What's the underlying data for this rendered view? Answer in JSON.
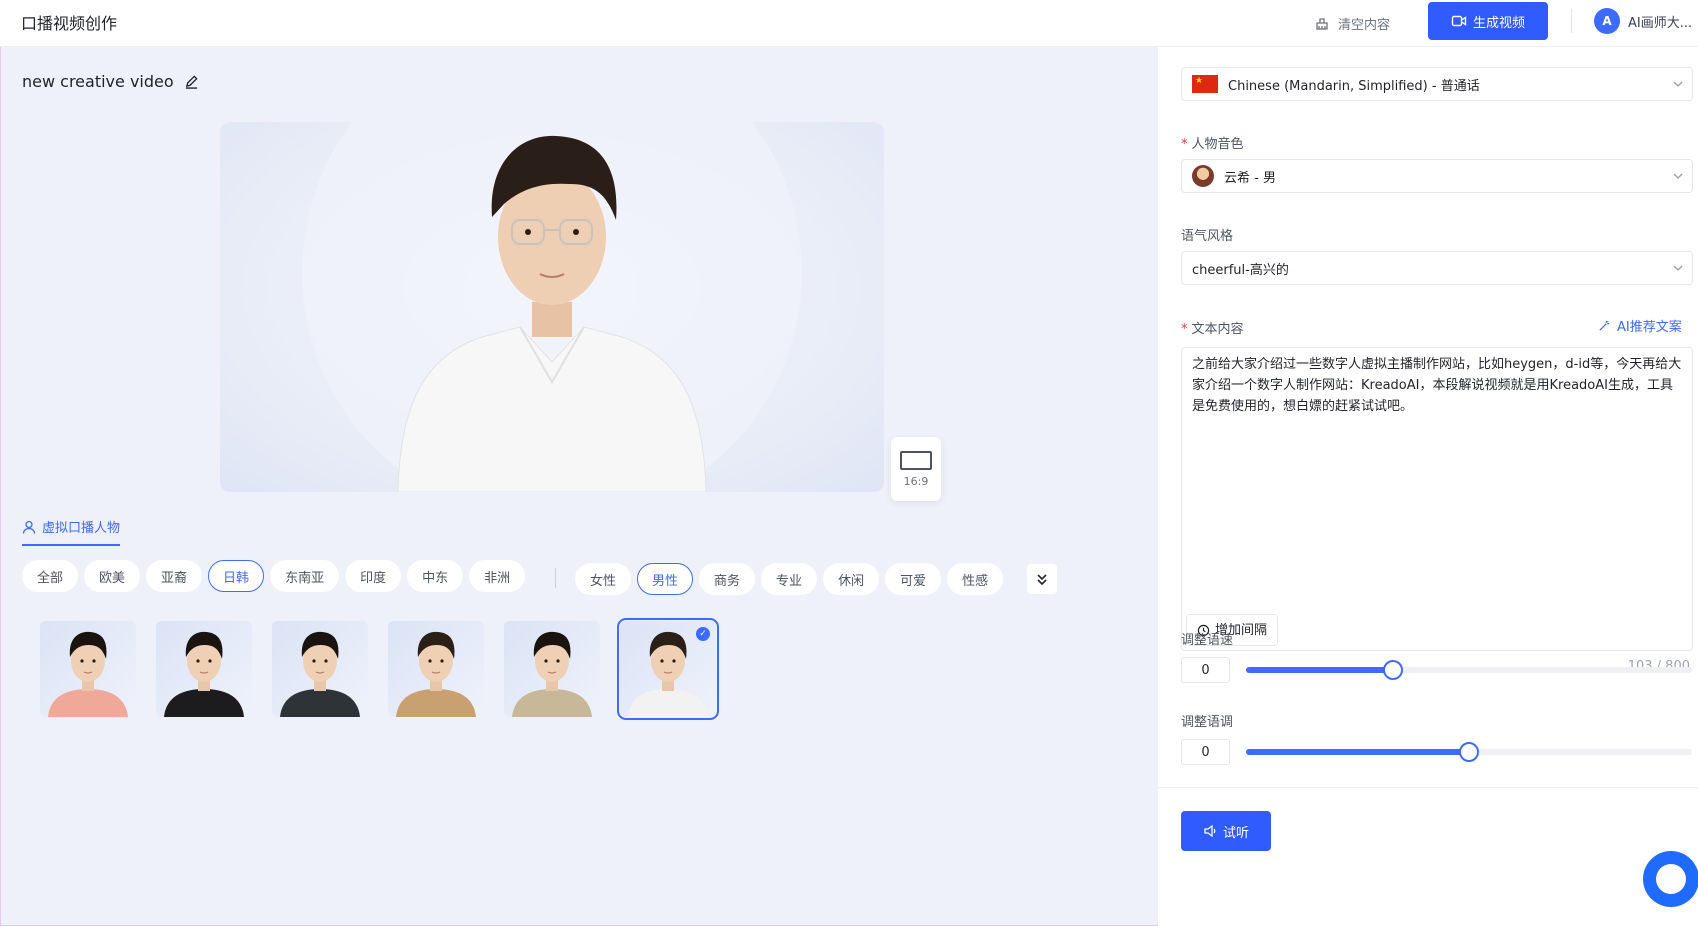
{
  "header": {
    "app_title": "口播视频创作",
    "clear_label": "清空内容",
    "generate_label": "生成视频",
    "avatar_initial": "A",
    "user_name": "AI画师大..."
  },
  "editor": {
    "video_title": "new creative video",
    "aspect_ratio": "16:9",
    "section_tab": "虚拟口播人物",
    "region_filters": [
      {
        "label": "全部",
        "active": false
      },
      {
        "label": "欧美",
        "active": false
      },
      {
        "label": "亚裔",
        "active": false
      },
      {
        "label": "日韩",
        "active": true
      },
      {
        "label": "东南亚",
        "active": false
      },
      {
        "label": "印度",
        "active": false
      },
      {
        "label": "中东",
        "active": false
      },
      {
        "label": "非洲",
        "active": false
      }
    ],
    "tag_filters": [
      {
        "label": "女性",
        "active": false
      },
      {
        "label": "男性",
        "active": true
      },
      {
        "label": "商务",
        "active": false
      },
      {
        "label": "专业",
        "active": false
      },
      {
        "label": "休闲",
        "active": false
      },
      {
        "label": "可爱",
        "active": false
      },
      {
        "label": "性感",
        "active": false
      }
    ],
    "avatars": [
      {
        "shirt": "#f0a898",
        "hair": "#1a1410",
        "selected": false
      },
      {
        "shirt": "#1c1c1e",
        "hair": "#1a1410",
        "selected": false
      },
      {
        "shirt": "#2e3338",
        "hair": "#1a1410",
        "selected": false
      },
      {
        "shirt": "#c9a070",
        "hair": "#2a2018",
        "selected": false
      },
      {
        "shirt": "#c8b89a",
        "hair": "#1a1410",
        "selected": false
      },
      {
        "shirt": "#f2f2f2",
        "hair": "#2a2018",
        "selected": true
      }
    ]
  },
  "panel": {
    "language": "Chinese (Mandarin, Simplified) - 普通话",
    "voice_label": "人物音色",
    "voice_value": "云希 - 男",
    "style_label": "语气风格",
    "style_value": "cheerful-高兴的",
    "text_label": "文本内容",
    "ai_recommend": "AI推荐文案",
    "text_content": "之前给大家介绍过一些数字人虚拟主播制作网站，比如heygen，d-id等，今天再给大家介绍一个数字人制作网站：KreadoAI，本段解说视频就是用KreadoAI生成，工具是免费使用的，想白嫖的赶紧试试吧。",
    "add_interval": "增加间隔",
    "char_count": "103 / 800",
    "speed_label": "调整语速",
    "speed_value": "0",
    "speed_percent": 33,
    "pitch_label": "调整语调",
    "pitch_value": "0",
    "pitch_percent": 50,
    "listen_label": "试听"
  },
  "colors": {
    "accent": "#2f5bff",
    "background": "#eef1fa"
  }
}
